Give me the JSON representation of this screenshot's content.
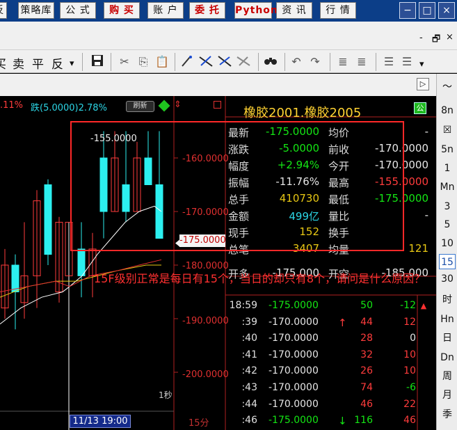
{
  "menu": {
    "items": [
      {
        "label": "反",
        "red": false
      },
      {
        "label": "策略库",
        "red": false
      },
      {
        "label": "公 式",
        "red": false
      },
      {
        "label": "购 买",
        "red": true
      },
      {
        "label": "账 户",
        "red": false
      },
      {
        "label": "委 托",
        "red": true
      },
      {
        "label": "Python",
        "red": true
      },
      {
        "label": "资 讯",
        "red": false
      },
      {
        "label": "行 情",
        "red": false
      }
    ],
    "window_buttons": [
      "−",
      "□",
      "×"
    ]
  },
  "toolbar": {
    "minimize_label": "-",
    "restore_label": "🗗",
    "close_label": "×",
    "order_buttons": [
      "买",
      "卖",
      "平",
      "反"
    ],
    "dropdown_glyph": "▾",
    "icons": [
      "save-icon",
      "cut-icon",
      "copy-icon",
      "paste-icon",
      "draw-icon",
      "tool-a-icon",
      "tool-b-icon",
      "tool-c-icon",
      "binoculars-icon",
      "undo-icon",
      "redo-icon",
      "indent-icon",
      "outdent-icon",
      "list-icon",
      "list2-icon"
    ],
    "sub_arrow": "▷"
  },
  "chart": {
    "info_change_percent": ".11%",
    "info_fall": "跌(5.0000)2.78%",
    "refresh_label": "刷新",
    "high_marker": "-155.0000",
    "price_ticks": [
      "-160.0000",
      "-170.0000",
      "-180.0000",
      "-190.0000",
      "-200.0000"
    ],
    "current_tick": "-175.0000",
    "period_tag": "1秒",
    "date": "11/13 19:00",
    "period_label": "15分"
  },
  "quote": {
    "title": "橡胶2001.橡胶2005",
    "title_icon": "公",
    "rows": [
      {
        "l1": "最新",
        "v1": "-175.0000",
        "c1": "green",
        "l2": "均价",
        "v2": "-",
        "c2": "white"
      },
      {
        "l1": "涨跌",
        "v1": "-5.0000",
        "c1": "green",
        "l2": "前收",
        "v2": "-170.0000",
        "c2": "white"
      },
      {
        "l1": "幅度",
        "v1": "+2.94%",
        "c1": "green",
        "l2": "今开",
        "v2": "-170.0000",
        "c2": "white"
      },
      {
        "l1": "振幅",
        "v1": "-11.76%",
        "c1": "white",
        "l2": "最高",
        "v2": "-155.0000",
        "c2": "red"
      },
      {
        "l1": "总手",
        "v1": "410730",
        "c1": "yellow",
        "l2": "最低",
        "v2": "-175.0000",
        "c2": "green"
      },
      {
        "l1": "金额",
        "v1": "499亿",
        "c1": "cyan",
        "l2": "量比",
        "v2": "-",
        "c2": "white"
      },
      {
        "l1": "现手",
        "v1": "152",
        "c1": "yellow",
        "l2": "换手",
        "v2": "",
        "c2": "white"
      },
      {
        "l1": "总笔",
        "v1": "3407",
        "c1": "yellow",
        "l2": "均量",
        "v2": "121",
        "c2": "yellow"
      },
      {
        "l1": "开多",
        "v1": "-175.000",
        "c1": "white",
        "l2": "开空",
        "v2": "-185.000",
        "c2": "white"
      }
    ]
  },
  "ticks": [
    {
      "time": "18:59",
      "price": "-175.0000",
      "pc": "green",
      "arrow": "",
      "vol": "50",
      "vc": "green",
      "chg": "-12",
      "cc": "green"
    },
    {
      "time": ":39",
      "price": "-170.0000",
      "pc": "white",
      "arrow": "↑",
      "ac": "red",
      "vol": "44",
      "vc": "red",
      "chg": "12",
      "cc": "red"
    },
    {
      "time": ":40",
      "price": "-170.0000",
      "pc": "white",
      "arrow": "",
      "vol": "28",
      "vc": "red",
      "chg": "0",
      "cc": "white"
    },
    {
      "time": ":41",
      "price": "-170.0000",
      "pc": "white",
      "arrow": "",
      "vol": "32",
      "vc": "red",
      "chg": "10",
      "cc": "red"
    },
    {
      "time": ":42",
      "price": "-170.0000",
      "pc": "white",
      "arrow": "",
      "vol": "26",
      "vc": "red",
      "chg": "10",
      "cc": "red"
    },
    {
      "time": ":43",
      "price": "-170.0000",
      "pc": "white",
      "arrow": "",
      "vol": "74",
      "vc": "red",
      "chg": "-6",
      "cc": "green"
    },
    {
      "time": ":44",
      "price": "-170.0000",
      "pc": "white",
      "arrow": "",
      "vol": "46",
      "vc": "red",
      "chg": "22",
      "cc": "red"
    },
    {
      "time": ":46",
      "price": "-175.0000",
      "pc": "green",
      "arrow": "↓",
      "ac": "green",
      "vol": "116",
      "vc": "green",
      "chg": "46",
      "cc": "red"
    }
  ],
  "periods": [
    {
      "label": "〜",
      "active": false
    },
    {
      "label": "8n",
      "active": false
    },
    {
      "label": "☒",
      "active": false
    },
    {
      "label": "5n",
      "active": false
    },
    {
      "label": "1",
      "active": false
    },
    {
      "label": "Mn",
      "active": false
    },
    {
      "label": "3",
      "active": false
    },
    {
      "label": "5",
      "active": false
    },
    {
      "label": "10",
      "active": false
    },
    {
      "label": "15",
      "active": true
    },
    {
      "label": "30",
      "active": false
    },
    {
      "label": "时",
      "active": false
    },
    {
      "label": "Hn",
      "active": false
    },
    {
      "label": "日",
      "active": false
    },
    {
      "label": "Dn",
      "active": false
    },
    {
      "label": "周",
      "active": false
    },
    {
      "label": "月",
      "active": false
    },
    {
      "label": "季",
      "active": false
    }
  ],
  "annotation": "15F级别正常是每日有15个，当日的却只有8个，请问是什么原因？",
  "colors": {
    "bg": "#000000",
    "up": "#ff3c3c",
    "down": "#2cf0f0",
    "ma1": "#ffffff",
    "ma2": "#e8c814",
    "ma3": "#e03030"
  },
  "chart_data": {
    "type": "candlestick",
    "candles": [
      {
        "open": -177,
        "close": -182,
        "high": -172,
        "low": -186,
        "dir": "down"
      },
      {
        "open": -182,
        "close": -177,
        "high": -174,
        "low": -186,
        "dir": "up"
      },
      {
        "open": -160,
        "close": -170,
        "high": -155,
        "low": -175,
        "dir": "down"
      },
      {
        "open": -170,
        "close": -160,
        "high": -155,
        "low": -170,
        "dir": "up"
      },
      {
        "open": -165,
        "close": -170,
        "high": -155,
        "low": -172,
        "dir": "down"
      },
      {
        "open": -170,
        "close": -160,
        "high": -157,
        "low": -170,
        "dir": "up"
      },
      {
        "open": -160,
        "close": -165,
        "high": -155,
        "low": -165,
        "dir": "down"
      },
      {
        "open": -165,
        "close": -175,
        "high": -155,
        "low": -175,
        "dir": "down"
      }
    ],
    "ma_white": [
      -178,
      -175,
      -172,
      -171,
      -170,
      -169,
      -168,
      -169
    ],
    "price_range": [
      -205,
      -152
    ]
  }
}
